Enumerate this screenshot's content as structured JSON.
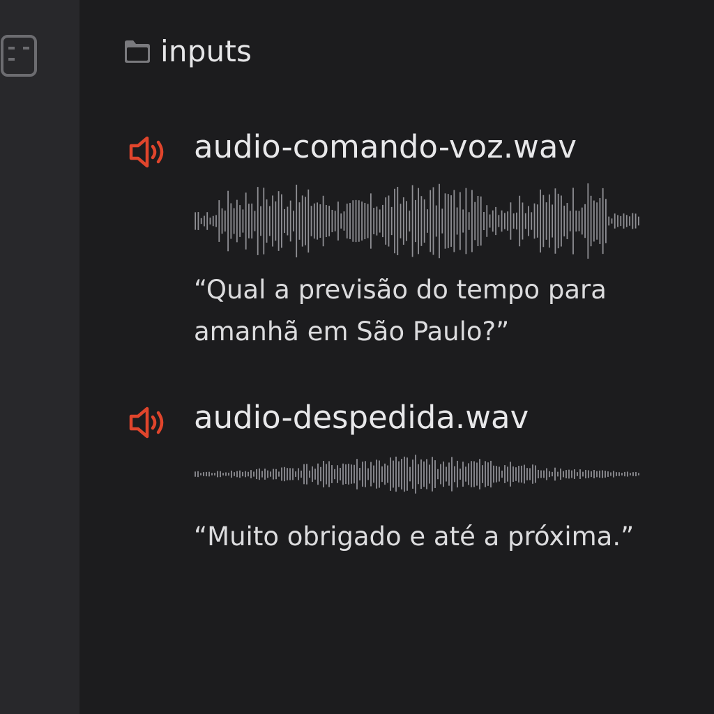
{
  "folder": {
    "title": "inputs",
    "icon": "folder-icon"
  },
  "sidebar": {
    "toggle_icon": "sidebar-toggle-icon"
  },
  "colors": {
    "accent": "#e0452c",
    "waveform": "#8f8f94",
    "background": "#1c1c1e",
    "sidebar": "#28282b"
  },
  "audio_files": [
    {
      "icon": "speaker-icon",
      "name": "audio-comando-voz.wav",
      "transcript": "“Qual a previsão do tempo para amanhã em São Paulo?”"
    },
    {
      "icon": "speaker-icon",
      "name": "audio-despedida.wav",
      "transcript": "“Muito obrigado e até a próxima.”"
    }
  ]
}
